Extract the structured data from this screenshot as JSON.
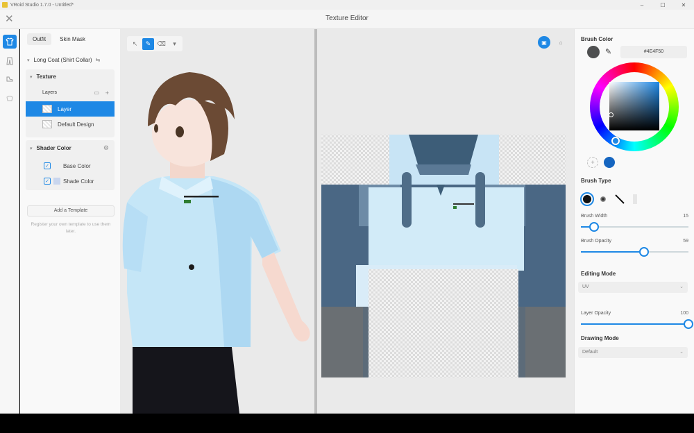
{
  "window": {
    "app_title": "VRoid Studio 1.7.0 - Untitled*",
    "controls": [
      "–",
      "☐",
      "✕"
    ]
  },
  "header": {
    "close_icon": "close-icon",
    "title": "Texture Editor"
  },
  "sidebar_icons": [
    "shirt-icon",
    "pants-icon",
    "shoe-icon",
    "accessory-icon"
  ],
  "left_panel": {
    "tabs": [
      {
        "label": "Outfit",
        "active": true
      },
      {
        "label": "Skin Mask",
        "active": false
      }
    ],
    "item_name": "Long Coat (Shirt Collar)",
    "texture": {
      "heading": "Texture",
      "layers_label": "Layers",
      "layers": [
        {
          "name": "Layer",
          "selected": true
        },
        {
          "name": "Default Design",
          "selected": false
        }
      ]
    },
    "shader": {
      "heading": "Shader Color",
      "rows": [
        {
          "label": "Base Color",
          "checked": true
        },
        {
          "label": "Shade Color",
          "checked": true
        }
      ]
    },
    "add_template_label": "Add a Template",
    "hint": "Register your own template to use them later."
  },
  "viewport_tools": [
    "select-tool",
    "pen-tool",
    "eraser-tool",
    "fill-tool"
  ],
  "right_panel": {
    "brush_color": {
      "label": "Brush Color",
      "hex": "#4E4F50",
      "swatch": "#4e4f50"
    },
    "recent_colors": [
      "+",
      "#1565c0"
    ],
    "brush_type": {
      "label": "Brush Type",
      "options": [
        "round-brush",
        "soft-brush",
        "line-brush",
        "texture-brush"
      ]
    },
    "brush_width": {
      "label": "Brush Width",
      "value": "15",
      "fraction": 0.12
    },
    "brush_opacity": {
      "label": "Brush Opacity",
      "value": "59",
      "fraction": 0.59
    },
    "editing_mode": {
      "label": "Editing Mode",
      "value": "UV"
    },
    "layer_opacity": {
      "label": "Layer Opacity",
      "value": "100",
      "fraction": 1.0
    },
    "drawing_mode": {
      "label": "Drawing Mode",
      "value": "Default"
    }
  },
  "colors": {
    "accent": "#1e88e5",
    "shirt": "#bfe3f7",
    "uv_bg": "#4a6784"
  }
}
